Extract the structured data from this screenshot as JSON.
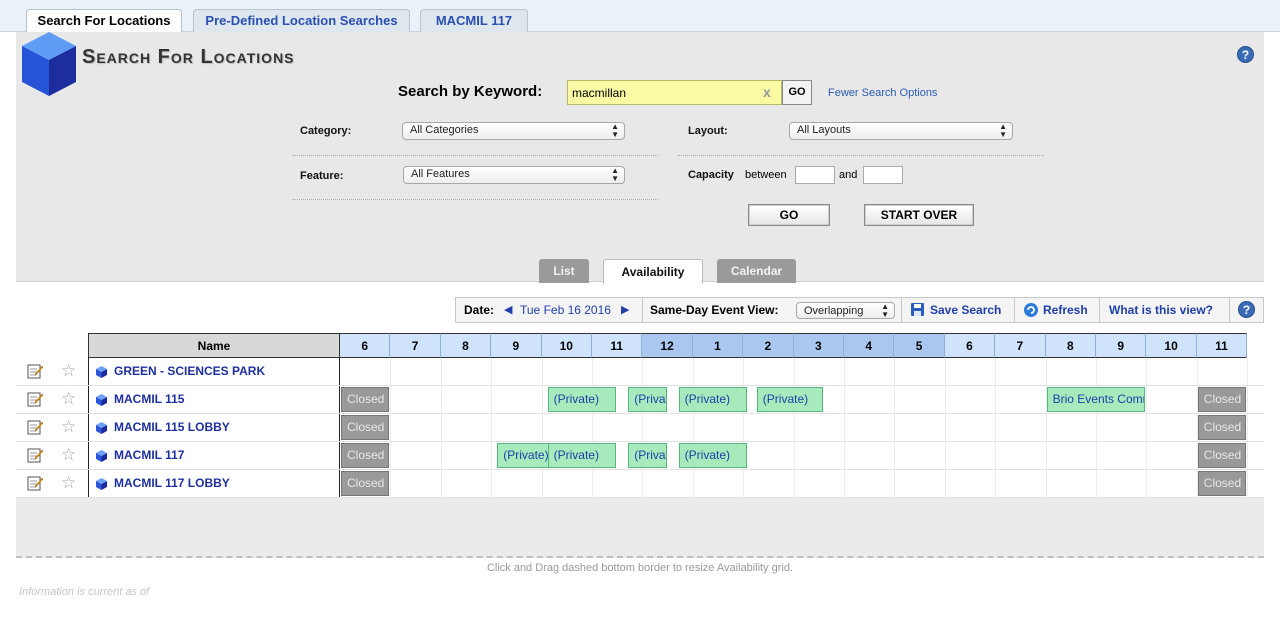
{
  "top_tabs": [
    {
      "label": "Search For Locations",
      "active": true
    },
    {
      "label": "Pre-Defined Location Searches",
      "active": false
    },
    {
      "label": "MACMIL 117",
      "active": false
    }
  ],
  "panel": {
    "title": "Search For Locations",
    "help_icon": "?",
    "keyword_label": "Search by Keyword:",
    "keyword_value": "macmillan",
    "keyword_clear": "x",
    "go_small": "GO",
    "fewer_options": "Fewer Search Options",
    "category_label": "Category:",
    "category_value": "All Categories",
    "layout_label": "Layout:",
    "layout_value": "All Layouts",
    "feature_label": "Feature:",
    "feature_value": "All Features",
    "capacity_label": "Capacity",
    "capacity_between": "between",
    "capacity_and": "and",
    "go_button": "GO",
    "start_over": "START OVER"
  },
  "view_tabs": [
    {
      "label": "List",
      "active": false
    },
    {
      "label": "Availability",
      "active": true
    },
    {
      "label": "Calendar",
      "active": false
    }
  ],
  "toolbar": {
    "date_label": "Date:",
    "date_value": "Tue Feb 16 2016",
    "same_day_label": "Same-Day Event View:",
    "same_day_value": "Overlapping",
    "save_search": "Save Search",
    "refresh": "Refresh",
    "what_is": "What is this view?",
    "help": "?"
  },
  "grid": {
    "name_header": "Name",
    "hours": [
      "6",
      "7",
      "8",
      "9",
      "10",
      "11",
      "12",
      "1",
      "2",
      "3",
      "4",
      "5",
      "6",
      "7",
      "8",
      "9",
      "10",
      "11"
    ],
    "rows": [
      {
        "name": "GREEN - SCIENCES PARK",
        "events": []
      },
      {
        "name": "MACMIL 115",
        "events": [
          {
            "label": "Closed",
            "kind": "closed",
            "start": 6,
            "end": 7
          },
          {
            "label": "(Private)",
            "kind": "event",
            "start": 10.1,
            "end": 11.5
          },
          {
            "label": "(Private)",
            "kind": "event",
            "start": 11.7,
            "end": 12.5
          },
          {
            "label": "(Private)",
            "kind": "event",
            "start": 12.7,
            "end": 14.1
          },
          {
            "label": "(Private)",
            "kind": "event",
            "start": 14.25,
            "end": 15.6
          },
          {
            "label": "Brio Events Committee",
            "kind": "event",
            "start": 20,
            "end": 22
          },
          {
            "label": "Closed",
            "kind": "closed",
            "start": 23,
            "end": 24
          }
        ]
      },
      {
        "name": "MACMIL 115 LOBBY",
        "events": [
          {
            "label": "Closed",
            "kind": "closed",
            "start": 6,
            "end": 7
          },
          {
            "label": "Closed",
            "kind": "closed",
            "start": 23,
            "end": 24
          }
        ]
      },
      {
        "name": "MACMIL 117",
        "events": [
          {
            "label": "Closed",
            "kind": "closed",
            "start": 6,
            "end": 7
          },
          {
            "label": "(Private)",
            "kind": "event",
            "start": 9.1,
            "end": 10.45
          },
          {
            "label": "(Private)",
            "kind": "event",
            "start": 10.1,
            "end": 11.5
          },
          {
            "label": "(Private)",
            "kind": "event",
            "start": 11.7,
            "end": 12.5
          },
          {
            "label": "(Private)",
            "kind": "event",
            "start": 12.7,
            "end": 14.1
          },
          {
            "label": "Closed",
            "kind": "closed",
            "start": 23,
            "end": 24
          }
        ]
      },
      {
        "name": "MACMIL 117 LOBBY",
        "events": [
          {
            "label": "Closed",
            "kind": "closed",
            "start": 6,
            "end": 7
          },
          {
            "label": "Closed",
            "kind": "closed",
            "start": 23,
            "end": 24
          }
        ]
      }
    ]
  },
  "resize_hint": "Click and Drag dashed bottom border to resize Availability grid.",
  "info_text": "Information is current as of"
}
